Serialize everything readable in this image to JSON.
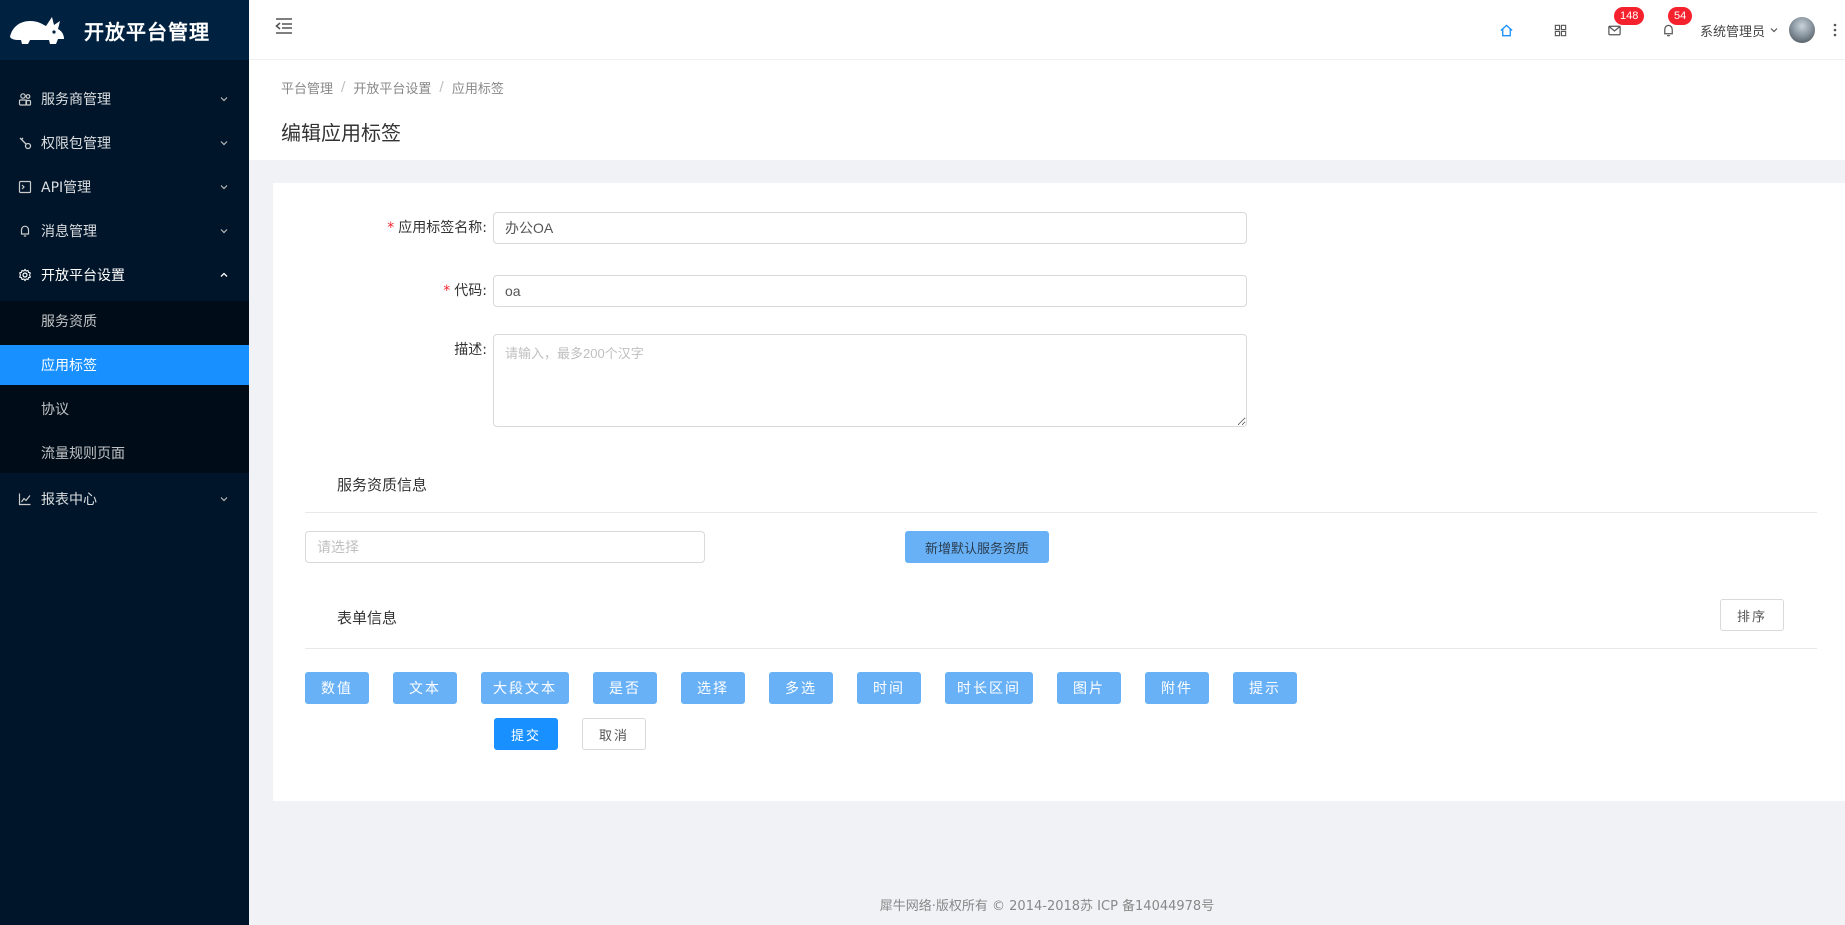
{
  "app": {
    "title": "开放平台管理"
  },
  "sidebar": {
    "items": [
      {
        "label": "服务商管理",
        "icon": "team-icon"
      },
      {
        "label": "权限包管理",
        "icon": "key-icon"
      },
      {
        "label": "API管理",
        "icon": "api-icon"
      },
      {
        "label": "消息管理",
        "icon": "bell-icon"
      },
      {
        "label": "开放平台设置",
        "icon": "gear-icon"
      },
      {
        "label": "报表中心",
        "icon": "line-chart-icon"
      }
    ],
    "submenu": [
      {
        "label": "服务资质"
      },
      {
        "label": "应用标签"
      },
      {
        "label": "协议"
      },
      {
        "label": "流量规则页面"
      }
    ]
  },
  "header": {
    "mail_badge": "148",
    "bell_badge": "54",
    "user_name": "系统管理员"
  },
  "breadcrumb": [
    "平台管理",
    "开放平台设置",
    "应用标签"
  ],
  "page_title": "编辑应用标签",
  "form": {
    "name_label": "应用标签名称",
    "name_value": "办公OA",
    "code_label": "代码",
    "code_value": "oa",
    "desc_label": "描述",
    "desc_placeholder": "请输入，最多200个汉字",
    "colon": ":"
  },
  "service_section": {
    "title": "服务资质信息",
    "select_placeholder": "请选择",
    "add_button": "新增默认服务资质"
  },
  "form_section": {
    "title": "表单信息",
    "sort_button": "排序",
    "field_types": [
      "数值",
      "文本",
      "大段文本",
      "是否",
      "选择",
      "多选",
      "时间",
      "时长区间",
      "图片",
      "附件",
      "提示"
    ]
  },
  "actions": {
    "submit": "提交",
    "cancel": "取消"
  },
  "footer": {
    "copyright": "犀牛网络·版权所有 © 2014-2018苏 ICP 备14044978号"
  },
  "colors": {
    "sidebar_bg": "#001529",
    "primary": "#1890ff",
    "light_primary": "#69b1f7",
    "badge": "#f5222d"
  }
}
